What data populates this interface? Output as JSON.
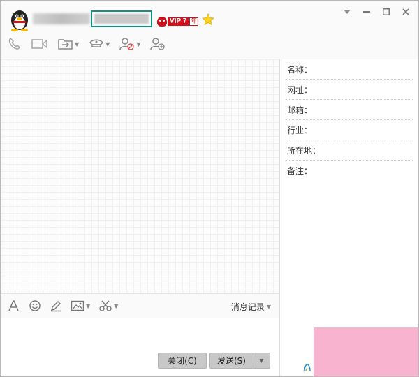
{
  "header": {
    "vip_label": "VIP 7",
    "vip_year": "年"
  },
  "profile_fields": [
    {
      "label": "名称："
    },
    {
      "label": "网址："
    },
    {
      "label": "邮箱："
    },
    {
      "label": "行业："
    },
    {
      "label": "所在地："
    },
    {
      "label": "备注："
    }
  ],
  "input_bar": {
    "history_label": "消息记录"
  },
  "buttons": {
    "close_label": "关闭(C)",
    "send_label": "发送(S)"
  },
  "colors": {
    "accent_box": "#178f7f",
    "vip_red": "#d8101c",
    "overlay_pink": "#f8b4cf"
  }
}
